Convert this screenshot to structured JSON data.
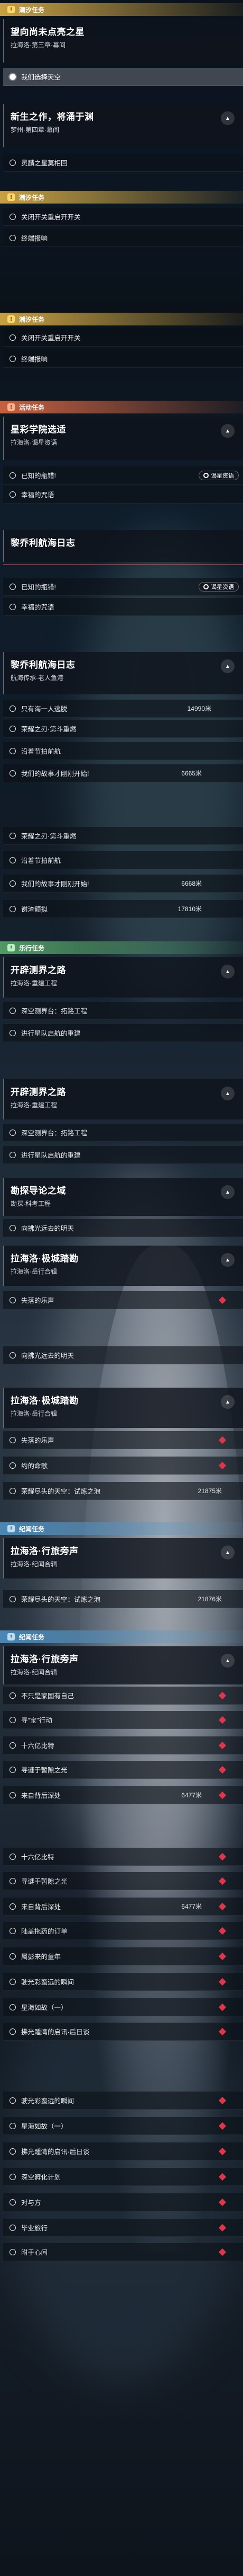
{
  "tasks": {
    "t1": {
      "header": "潮汐任务",
      "title": "望向尚未点亮之星",
      "sub": "拉海洛·第三章·幕间",
      "steps": [
        "我们选择天空"
      ]
    },
    "t2": {
      "title": "新生之作，将涌于渊",
      "sub": "梦州·第四章·幕间",
      "steps": [
        "灵麟之星莫相回"
      ]
    },
    "t3": {
      "header": "潮汐任务",
      "steps": [
        "关闭开关重启开开关",
        "终端报响"
      ]
    },
    "t4": {
      "header": "潮汐任务",
      "steps": [
        "关闭开关重启开开关",
        "终端报响"
      ]
    },
    "t5": {
      "header": "活动任务",
      "title": "星彩学院选适",
      "sub": "拉海洛·谒星资语",
      "steps": [
        "已知的瓶错!",
        "幸福的咒语"
      ],
      "badge": "谒星资语"
    },
    "t6": {
      "title": "黎乔利航海日志",
      "sub": "",
      "steps": [
        "已知的瓶错!",
        "幸福的咒语"
      ],
      "badge": "谒星资语"
    },
    "t7": {
      "title": "黎乔利航海日志",
      "sub": "航海传承·老人鱼港",
      "badge": "航海传承",
      "steps": [
        {
          "label": "只有海一人逃脱",
          "count": "14990米"
        },
        {
          "label": "荣耀之刃·第斗重燃",
          "count": ""
        },
        {
          "label": "沿着节拍前航",
          "count": ""
        },
        {
          "label": "我们的故事才刚刚开始!",
          "count": "6665米"
        }
      ]
    },
    "t8": {
      "steps": [
        {
          "label": "荣耀之刃·第斗重燃",
          "count": ""
        },
        {
          "label": "沿着节拍前航",
          "count": ""
        },
        {
          "label": "我们的故事才刚刚开始!",
          "count": "6668米"
        },
        {
          "label": "谢渣额拟",
          "count": "17810米"
        }
      ]
    },
    "t9": {
      "header": "乐行任务",
      "title": "开辟测界之路",
      "sub": "拉海洛·重建工程",
      "steps": [
        "深空测界台：拓路工程",
        "进行星队启航的重建"
      ]
    },
    "t10": {
      "title": "开辟测界之路",
      "sub": "拉海洛·重建工程",
      "steps": [
        "深空测界台：拓路工程",
        "进行星队启航的重建"
      ]
    },
    "t11": {
      "title": "勘探导论之域",
      "sub": "勘探·科考工程",
      "steps": [
        "向拂光远去的明天"
      ]
    },
    "t12": {
      "title": "拉海洛·极城踏勘",
      "sub": "拉海洛·岳行合辑",
      "steps": [
        "失落的乐声"
      ]
    },
    "t13": {
      "steps": [
        "向拂光远去的明天"
      ]
    },
    "t14": {
      "title": "拉海洛·极城踏勘",
      "sub": "拉海洛·岳行合辑",
      "steps": [
        {
          "label": "失落的乐声",
          "count": ""
        },
        {
          "label": "约的命歌",
          "count": ""
        },
        {
          "label": "荣耀尽头的天空：试炼之泡",
          "count": "21875米"
        }
      ]
    },
    "t15": {
      "header": "纪闻任务",
      "title": "拉海洛·行旅旁声",
      "sub": "拉海洛·纪闻合辑",
      "steps": [
        {
          "label": "荣耀尽头的天空：试炼之泡",
          "count": "21876米"
        }
      ]
    },
    "t16": {
      "header": "纪闻任务",
      "title": "拉海洛·行旅旁声",
      "sub": "拉海洛·纪闻合辑",
      "steps": [
        {
          "label": "不只是家国有自己",
          "count": ""
        },
        {
          "label": "寻\"宝\"行动",
          "count": ""
        },
        {
          "label": "十六亿比特",
          "count": ""
        },
        {
          "label": "寻谜于暂隙之光",
          "count": ""
        },
        {
          "label": "来自背后深处",
          "count": "6477米"
        },
        {
          "label": "十六亿比特",
          "count": ""
        },
        {
          "label": "寻谜于暂隙之光",
          "count": ""
        },
        {
          "label": "来自背后深处",
          "count": "6477米"
        },
        {
          "label": "陆盖拖药的订单",
          "count": ""
        },
        {
          "label": "属彭来的童年",
          "count": ""
        },
        {
          "label": "驶光彩蛮远的瞬间",
          "count": ""
        },
        {
          "label": "星海如故（一）",
          "count": ""
        },
        {
          "label": "拂光踵湾的启讯·后日谈",
          "count": ""
        },
        {
          "label": "驶光彩蛮远的瞬间",
          "count": ""
        },
        {
          "label": "星海如故（一）",
          "count": ""
        },
        {
          "label": "拂光踵湾的启讯·后日谈",
          "count": ""
        },
        {
          "label": "深空孵化计划",
          "count": ""
        },
        {
          "label": "对与方",
          "count": ""
        },
        {
          "label": "毕业旅行",
          "count": ""
        },
        {
          "label": "附于心间",
          "count": ""
        }
      ]
    }
  },
  "colors": {
    "accent_red": "#e0364b",
    "yellow": "#e8b94a",
    "orange": "#e66e46",
    "green": "#5aaf6e",
    "blue": "#5096c8"
  },
  "icons": {
    "header": "exclamation-icon",
    "step": "circle-icon",
    "toggle": "chevron-up-icon",
    "track": "red-diamond-icon",
    "badge": "star-circle-icon"
  }
}
